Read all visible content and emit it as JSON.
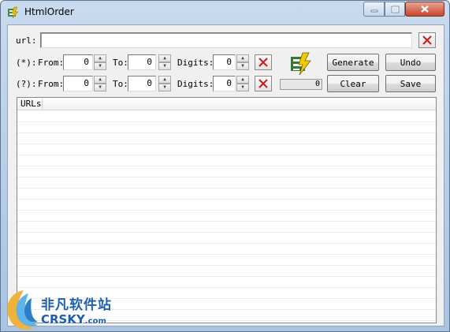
{
  "window": {
    "title": "HtmlOrder",
    "controls": [
      "minimize",
      "maximize",
      "close"
    ]
  },
  "url_row": {
    "label": "url:",
    "value": "",
    "clear_icon": "red-x-icon"
  },
  "star_row": {
    "label": "(*):",
    "from_label": "From:",
    "from_value": "0",
    "to_label": "To:",
    "to_value": "0",
    "digits_label": "Digits:",
    "digits_value": "0"
  },
  "question_row": {
    "label": "(?):",
    "from_label": "From:",
    "from_value": "0",
    "to_label": "To:",
    "to_value": "0",
    "digits_label": "Digits:",
    "digits_value": "0"
  },
  "buttons": {
    "generate": "Generate",
    "undo": "Undo",
    "clear": "Clear",
    "save": "Save"
  },
  "progress": {
    "value": "0"
  },
  "list": {
    "column_header": "URLs",
    "rows": []
  },
  "watermark": {
    "cn": "非凡软件站",
    "en_main": "CRSKY",
    "en_suffix": ".com"
  },
  "colors": {
    "close_button": "#c8452c",
    "red_x": "#cc1a1a",
    "watermark": "#1c5fb0"
  }
}
